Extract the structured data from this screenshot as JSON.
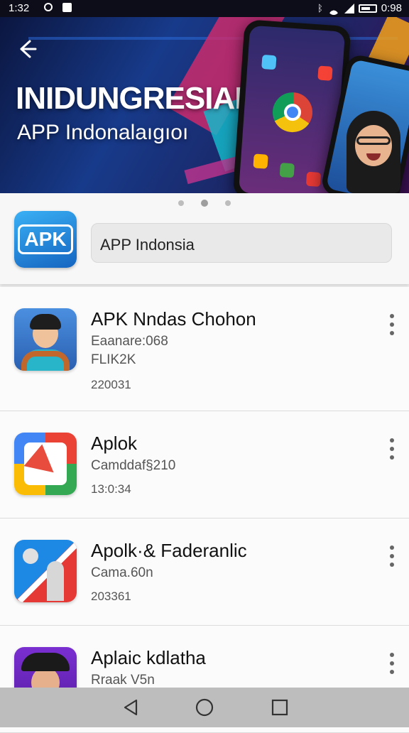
{
  "status_bar": {
    "time": "1:32",
    "battery_text": "0:98"
  },
  "hero": {
    "title": "INIDUNGRESIAI",
    "subtitle": "APP Indonalaıgıoı"
  },
  "carousel": {
    "dot_count": 3,
    "active_index": 1
  },
  "header": {
    "search_value": "APP Indonsia"
  },
  "apps": [
    {
      "title": "APK Nndas Chohon",
      "line1": "Eaanare:068",
      "line2": "FLIK2K",
      "line3": "220031"
    },
    {
      "title": "Aplok",
      "line1": "Camddaf§210",
      "line2": "",
      "line3": "13:0:34"
    },
    {
      "title": "Apolk·& Faderanlic",
      "line1": "Cama.60n",
      "line2": "",
      "line3": "203361"
    },
    {
      "title": "Aplaic kdlatha",
      "line1": "Rraak V5n",
      "line2": "",
      "line3": ""
    }
  ],
  "icons": {
    "back": "arrow-left-icon",
    "more": "more-vertical-icon",
    "nav_back": "triangle-back-icon",
    "nav_home": "circle-home-icon",
    "nav_recent": "square-recent-icon"
  },
  "colors": {
    "banner_start": "#0b1640",
    "banner_end": "#3a1050",
    "nav_bar": "#bdbdbd",
    "apk_logo": "#1e88e5"
  }
}
